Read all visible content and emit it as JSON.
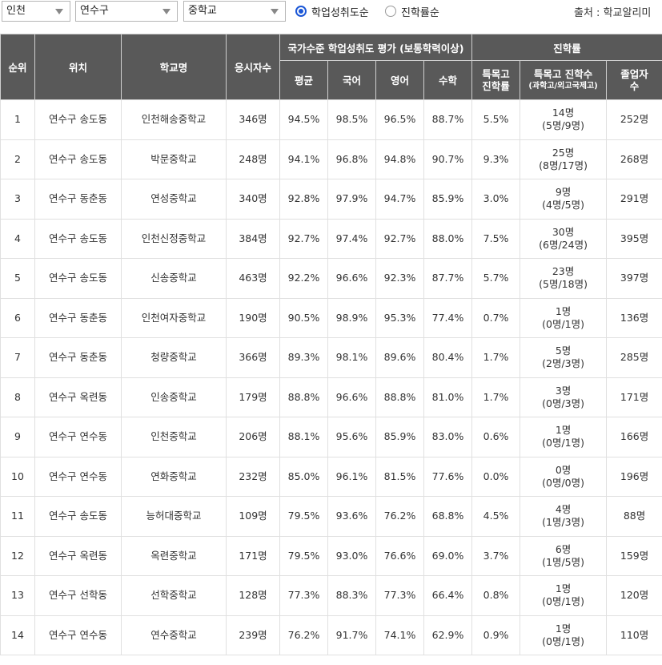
{
  "filters": {
    "region": "인천",
    "district": "연수구",
    "level": "중학교",
    "sort_options": [
      {
        "label": "학업성취도순",
        "checked": true
      },
      {
        "label": "진학률순",
        "checked": false
      }
    ],
    "source": "출처 : 학교알리미"
  },
  "colors": {
    "header_bg": "#595959",
    "radio_accent": "#1a56d6"
  },
  "table": {
    "headers": {
      "rank": "순위",
      "location": "위치",
      "school": "학교명",
      "examinees": "응시자수",
      "group_achievement": "국가수준 학업성취도 평가 (보통학력이상)",
      "avg": "평균",
      "korean": "국어",
      "english": "영어",
      "math": "수학",
      "group_advance": "진학률",
      "special_rate": "특목고 진학률",
      "special_count": "특목고 진학수",
      "special_count_sub": "(과학고/외고국제고)",
      "graduates": "졸업자수"
    },
    "rows": [
      {
        "rank": "1",
        "location": "연수구 송도동",
        "school": "인천해송중학교",
        "examinees": "346명",
        "avg": "94.5%",
        "korean": "98.5%",
        "english": "96.5%",
        "math": "88.7%",
        "special_rate": "5.5%",
        "special_count": "14명",
        "special_detail": "(5명/9명)",
        "graduates": "252명"
      },
      {
        "rank": "2",
        "location": "연수구 송도동",
        "school": "박문중학교",
        "examinees": "248명",
        "avg": "94.1%",
        "korean": "96.8%",
        "english": "94.8%",
        "math": "90.7%",
        "special_rate": "9.3%",
        "special_count": "25명",
        "special_detail": "(8명/17명)",
        "graduates": "268명"
      },
      {
        "rank": "3",
        "location": "연수구 동춘동",
        "school": "연성중학교",
        "examinees": "340명",
        "avg": "92.8%",
        "korean": "97.9%",
        "english": "94.7%",
        "math": "85.9%",
        "special_rate": "3.0%",
        "special_count": "9명",
        "special_detail": "(4명/5명)",
        "graduates": "291명"
      },
      {
        "rank": "4",
        "location": "연수구 송도동",
        "school": "인천신정중학교",
        "examinees": "384명",
        "avg": "92.7%",
        "korean": "97.4%",
        "english": "92.7%",
        "math": "88.0%",
        "special_rate": "7.5%",
        "special_count": "30명",
        "special_detail": "(6명/24명)",
        "graduates": "395명"
      },
      {
        "rank": "5",
        "location": "연수구 송도동",
        "school": "신송중학교",
        "examinees": "463명",
        "avg": "92.2%",
        "korean": "96.6%",
        "english": "92.3%",
        "math": "87.7%",
        "special_rate": "5.7%",
        "special_count": "23명",
        "special_detail": "(5명/18명)",
        "graduates": "397명"
      },
      {
        "rank": "6",
        "location": "연수구 동춘동",
        "school": "인천여자중학교",
        "examinees": "190명",
        "avg": "90.5%",
        "korean": "98.9%",
        "english": "95.3%",
        "math": "77.4%",
        "special_rate": "0.7%",
        "special_count": "1명",
        "special_detail": "(0명/1명)",
        "graduates": "136명"
      },
      {
        "rank": "7",
        "location": "연수구 동춘동",
        "school": "청량중학교",
        "examinees": "366명",
        "avg": "89.3%",
        "korean": "98.1%",
        "english": "89.6%",
        "math": "80.4%",
        "special_rate": "1.7%",
        "special_count": "5명",
        "special_detail": "(2명/3명)",
        "graduates": "285명"
      },
      {
        "rank": "8",
        "location": "연수구 옥련동",
        "school": "인송중학교",
        "examinees": "179명",
        "avg": "88.8%",
        "korean": "96.6%",
        "english": "88.8%",
        "math": "81.0%",
        "special_rate": "1.7%",
        "special_count": "3명",
        "special_detail": "(0명/3명)",
        "graduates": "171명"
      },
      {
        "rank": "9",
        "location": "연수구 연수동",
        "school": "인천중학교",
        "examinees": "206명",
        "avg": "88.1%",
        "korean": "95.6%",
        "english": "85.9%",
        "math": "83.0%",
        "special_rate": "0.6%",
        "special_count": "1명",
        "special_detail": "(0명/1명)",
        "graduates": "166명"
      },
      {
        "rank": "10",
        "location": "연수구 연수동",
        "school": "연화중학교",
        "examinees": "232명",
        "avg": "85.0%",
        "korean": "96.1%",
        "english": "81.5%",
        "math": "77.6%",
        "special_rate": "0.0%",
        "special_count": "0명",
        "special_detail": "(0명/0명)",
        "graduates": "196명"
      },
      {
        "rank": "11",
        "location": "연수구 송도동",
        "school": "능허대중학교",
        "examinees": "109명",
        "avg": "79.5%",
        "korean": "93.6%",
        "english": "76.2%",
        "math": "68.8%",
        "special_rate": "4.5%",
        "special_count": "4명",
        "special_detail": "(1명/3명)",
        "graduates": "88명"
      },
      {
        "rank": "12",
        "location": "연수구 옥련동",
        "school": "옥련중학교",
        "examinees": "171명",
        "avg": "79.5%",
        "korean": "93.0%",
        "english": "76.6%",
        "math": "69.0%",
        "special_rate": "3.7%",
        "special_count": "6명",
        "special_detail": "(1명/5명)",
        "graduates": "159명"
      },
      {
        "rank": "13",
        "location": "연수구 선학동",
        "school": "선학중학교",
        "examinees": "128명",
        "avg": "77.3%",
        "korean": "88.3%",
        "english": "77.3%",
        "math": "66.4%",
        "special_rate": "0.8%",
        "special_count": "1명",
        "special_detail": "(0명/1명)",
        "graduates": "120명"
      },
      {
        "rank": "14",
        "location": "연수구 연수동",
        "school": "연수중학교",
        "examinees": "239명",
        "avg": "76.2%",
        "korean": "91.7%",
        "english": "74.1%",
        "math": "62.9%",
        "special_rate": "0.9%",
        "special_count": "1명",
        "special_detail": "(0명/1명)",
        "graduates": "110명"
      }
    ]
  }
}
